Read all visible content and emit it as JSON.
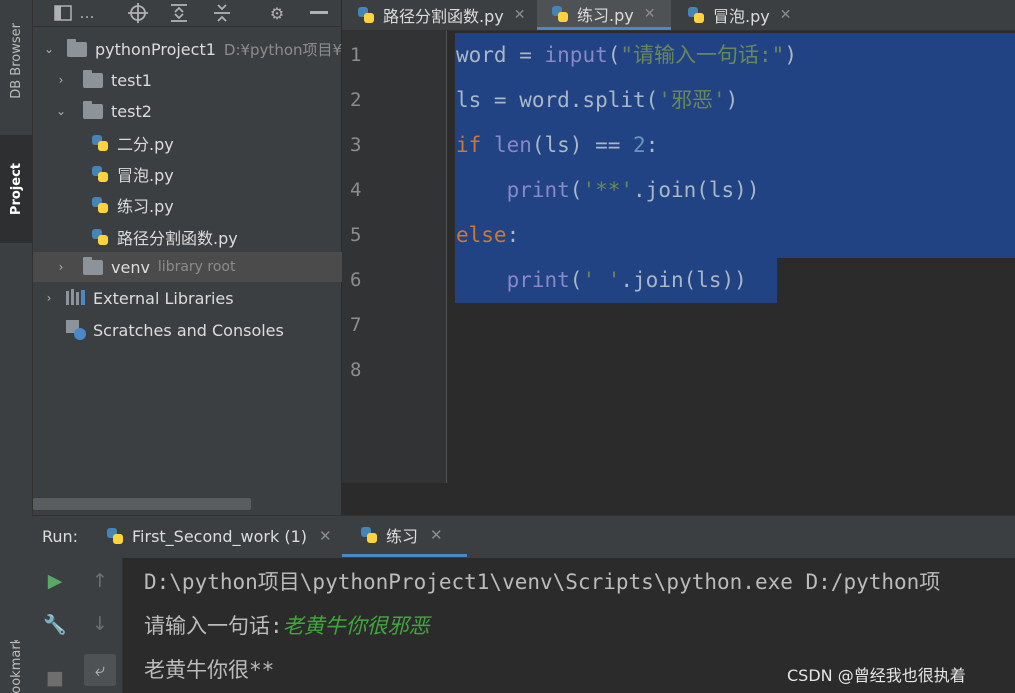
{
  "side_tabs": {
    "db_browser": "DB Browser",
    "project": "Project",
    "bookmarks": "Bookmarks"
  },
  "project_toolbar": {
    "title": "…"
  },
  "project_tree": {
    "root": {
      "name": "pythonProject1",
      "path": "D:¥python项目¥"
    },
    "test1": "test1",
    "test2": "test2",
    "files": [
      "二分.py",
      "冒泡.py",
      "练习.py",
      "路径分割函数.py"
    ],
    "venv": {
      "name": "venv",
      "hint": "library root"
    },
    "external_libraries": "External Libraries",
    "scratches": "Scratches and Consoles"
  },
  "editor_tabs": [
    "路径分割函数.py",
    "练习.py",
    "冒泡.py"
  ],
  "line_numbers": [
    "1",
    "2",
    "3",
    "4",
    "5",
    "6",
    "7",
    "8"
  ],
  "code": {
    "l1": {
      "a": "word = ",
      "b": "input",
      "c": "(",
      "d": "\"请输入一句话:\"",
      "e": ")"
    },
    "l2": {
      "a": "ls = word.split(",
      "b": "'邪恶'",
      "c": ")"
    },
    "l3": {
      "a": "if ",
      "b": "len",
      "c": "(ls) == ",
      "d": "2",
      "e": ":"
    },
    "l4": {
      "a": "    ",
      "b": "print",
      "c": "(",
      "d": "'**'",
      "e": ".join(ls))"
    },
    "l5": {
      "a": "else",
      "b": ":"
    },
    "l6": {
      "a": "    ",
      "b": "print",
      "c": "(",
      "d": "' '",
      "e": ".join(ls))"
    }
  },
  "run": {
    "label": "Run:",
    "tabs": [
      "First_Second_work (1)",
      "练习"
    ],
    "console": {
      "cmd": "D:\\python项目\\pythonProject1\\venv\\Scripts\\python.exe D:/python项",
      "prompt": "请输入一句话:",
      "user_input": "老黄牛你很邪恶",
      "output": "老黄牛你很**"
    }
  },
  "watermark": "CSDN @曾经我也很执着",
  "colors": {
    "selection": "#214283",
    "keyword": "#cc7832",
    "builtin": "#8888c6",
    "string": "#6a8759",
    "number": "#6897bb",
    "accent": "#4a88c7"
  }
}
